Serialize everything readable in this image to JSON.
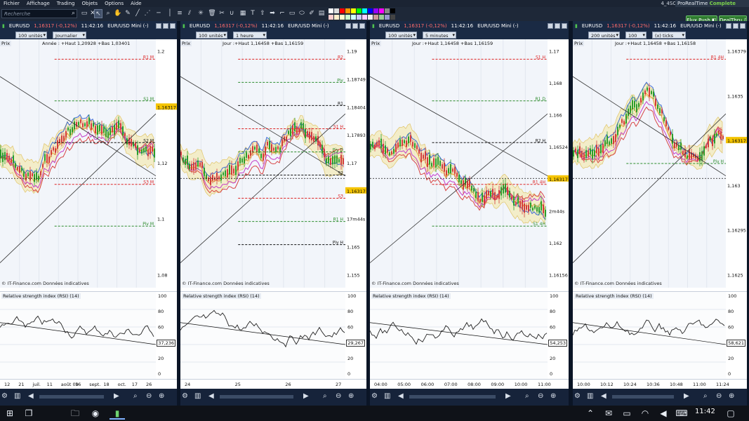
{
  "menu": {
    "items": [
      "Fichier",
      "Affichage",
      "Trading",
      "Objets",
      "Options",
      "Aide"
    ],
    "workspace": "4_4SCR_SingleProd_smallUnit_2"
  },
  "header": {
    "brand": "ProRealTime",
    "brand_suffix": "Complete",
    "flux": "Flux Push",
    "deal": "DealThru"
  },
  "search": {
    "placeholder": "Recherche"
  },
  "toolbar": {
    "icons": [
      "cursor-icon",
      "zoom-icon",
      "pan-icon",
      "pencil-icon",
      "line-icon",
      "hline-icon",
      "vline-icon",
      "fibo-icon",
      "channel-icon",
      "delete-icon",
      "tools-icon",
      "magnet-icon",
      "text-icon",
      "alert-icon",
      "arrow-icon",
      "rect-icon",
      "ellipse-icon",
      "brush-icon"
    ]
  },
  "colors": {
    "accent": "#1a2a44",
    "up": "#2a9d2a",
    "down": "#d23b3b",
    "bollinger": "#f3e7a8",
    "rsi": "#222222"
  },
  "panels": [
    {
      "symbol": "EURUSD",
      "price": "1,16317 (-0,12%)",
      "time": "11:42:16",
      "name": "EUR/USD Mini (-)",
      "units": "100 unités",
      "period": "Journalier",
      "info": "Année : +Haut 1,20928 +Bas 1,03401",
      "prix": "Prix",
      "rsi_label": "Relative strength index (RSI) (14)",
      "rsi_value": "37,236",
      "credit": "© IT-Finance.com  Données indicatives",
      "price_axis": [
        "1,2",
        "1,16317",
        "1,12",
        "1,1",
        "1,08"
      ],
      "levels": [
        "R1 M",
        "S1 M",
        "S2 M",
        "S3 M",
        "Piv M"
      ],
      "x_ticks": [
        "12",
        "21",
        "juil.",
        "11",
        "août 09",
        "16",
        "sept.",
        "18",
        "oct.",
        "17",
        "26"
      ]
    },
    {
      "symbol": "EURUSD",
      "price": "1,16317 (-0,12%)",
      "time": "11:42:16",
      "name": "EUR/USD Mini (-)",
      "units": "100 unités",
      "period": "1 heure",
      "info": "Jour :+Haut 1,16458 +Bas 1,16159",
      "prix": "Prix",
      "rsi_label": "Relative strength index (RSI) (14)",
      "rsi_value": "29,267",
      "credit": "© IT-Finance.com  Données indicatives",
      "price_axis": [
        "1,19",
        "1,18749",
        "1,18404",
        "1,17893",
        "1,17",
        "1,16317",
        "17m44s",
        "1,165",
        "1,155"
      ],
      "levels": [
        "R2",
        "Piv",
        "R1",
        "S1 H",
        "Piv D",
        "S2",
        "S3",
        "R1 H",
        "Piv H"
      ],
      "x_ticks": [
        "24",
        "25",
        "26",
        "27"
      ]
    },
    {
      "symbol": "EURUSD",
      "price": "1,16317 (-0,12%)",
      "time": "11:42:16",
      "name": "EUR/USD Mini (-)",
      "units": "100 unités",
      "period": "5 minutes",
      "info": "Jour :+Haut 1,16458 +Bas 1,16159",
      "prix": "Prix",
      "rsi_label": "Relative strength index (RSI) (14)",
      "rsi_value": "54,253",
      "credit": "© IT-Finance.com  Données indicatives",
      "price_axis": [
        "1,17",
        "1,168",
        "1,166",
        "1,16524",
        "1,16317",
        "2m44s",
        "1,162",
        "1,16156"
      ],
      "levels": [
        "S1 H",
        "R1 D",
        "R2 H",
        "R1 4H",
        "S1 4H"
      ],
      "x_ticks": [
        "04:00",
        "05:00",
        "06:00",
        "07:00",
        "08:00",
        "09:00",
        "10:00",
        "11:00"
      ]
    },
    {
      "symbol": "EURUSD",
      "price": "1,16317 (-0,12%)",
      "time": "11:42:16",
      "name": "EUR/USD Mini (-)",
      "units": "200 unités",
      "period": "(x) ticks",
      "period_value": "100",
      "info": "Jour :+Haut 1,16458 +Bas 1,16158",
      "prix": "Prix",
      "rsi_label": "Relative strength index (RSI) (14)",
      "rsi_value": "58,621",
      "credit": "© IT-Finance.com  Données indicatives",
      "price_axis": [
        "1,16379",
        "1,1635",
        "1,16317",
        "1,163",
        "1,16295",
        "1,1625"
      ],
      "levels": [
        "R1 4H",
        "Piv H"
      ],
      "x_ticks": [
        "10:00",
        "10:12",
        "10:24",
        "10:36",
        "10:48",
        "11:00",
        "11:24"
      ]
    }
  ],
  "rsi_axis": [
    "100",
    "80",
    "60",
    "40",
    "20",
    "0"
  ],
  "taskbar": {
    "time": "11:42",
    "icons": [
      "windows-icon",
      "taskview-icon",
      "folder-icon",
      "chrome-icon",
      "prorealtime-icon"
    ]
  }
}
